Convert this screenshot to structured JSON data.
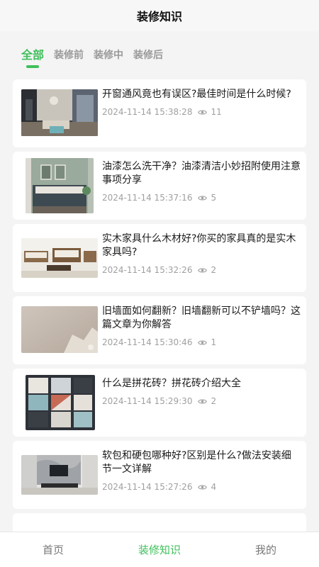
{
  "header": {
    "title": "装修知识"
  },
  "tabs": [
    {
      "label": "全部",
      "active": true
    },
    {
      "label": "装修前",
      "active": false
    },
    {
      "label": "装修中",
      "active": false
    },
    {
      "label": "装修后",
      "active": false
    }
  ],
  "articles": [
    {
      "title": "开窗通风竟也有误区?最佳时间是什么时候?",
      "date": "2024-11-14 15:38:28",
      "views": "11",
      "thumb": "living-room-dark"
    },
    {
      "title": "油漆怎么洗干净？油漆清洁小妙招附使用注意事项分享",
      "date": "2024-11-14 15:37:16",
      "views": "5",
      "thumb": "bedroom-sage"
    },
    {
      "title": "实木家具什么木材好?你买的家具真的是实木家具吗?",
      "date": "2024-11-14 15:32:26",
      "views": "2",
      "thumb": "wooden-sofa"
    },
    {
      "title": "旧墙面如何翻新？旧墙翻新可以不铲墙吗？这篇文章为你解答",
      "date": "2024-11-14 15:30:46",
      "views": "1",
      "thumb": "plaster-wall"
    },
    {
      "title": "什么是拼花砖？拼花砖介绍大全",
      "date": "2024-11-14 15:29:30",
      "views": "2",
      "thumb": "pattern-tile"
    },
    {
      "title": "软包和硬包哪种好?区别是什么?做法安装细节一文详解",
      "date": "2024-11-14 15:27:26",
      "views": "4",
      "thumb": "tv-wall"
    }
  ],
  "tabbar": [
    {
      "label": "首页",
      "active": false
    },
    {
      "label": "装修知识",
      "active": true
    },
    {
      "label": "我的",
      "active": false
    }
  ],
  "colors": {
    "accent": "#3fbf5b",
    "muted": "#a0a0a0"
  }
}
